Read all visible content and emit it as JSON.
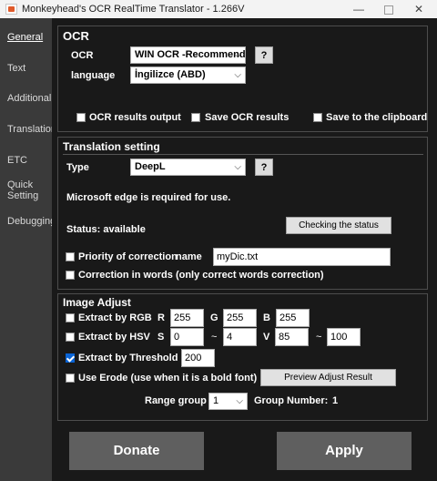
{
  "window": {
    "title": "Monkeyhead's OCR RealTime Translator - 1.266V",
    "min_glyph": "—",
    "close_glyph": "✕"
  },
  "sidebar": {
    "items": [
      {
        "label": "General",
        "active": true
      },
      {
        "label": "Text"
      },
      {
        "label": "Additional"
      },
      {
        "label": "Translation"
      },
      {
        "label": "ETC"
      },
      {
        "label": "Quick Setting"
      },
      {
        "label": "Debugging"
      }
    ]
  },
  "ocr": {
    "title": "OCR",
    "ocr_label": "OCR",
    "ocr_value": "WIN OCR -Recommended",
    "language_label": "language",
    "language_value": "İngilizce (ABD)",
    "help_label": "?",
    "results_output": {
      "label": "OCR results output",
      "checked": false
    },
    "save_results": {
      "label": "Save OCR results",
      "checked": false
    },
    "save_clipboard": {
      "label": "Save to the clipboard",
      "checked": false
    }
  },
  "translation": {
    "title": "Translation setting",
    "type_label": "Type",
    "type_value": "DeepL",
    "help_label": "?",
    "note": "Microsoft edge is required for use.",
    "status": "Status: available",
    "check_button": "Checking the status",
    "priority": {
      "label": "Priority of correction",
      "checked": false
    },
    "name_label": "name",
    "name_value": "myDic.txt",
    "words": {
      "label": "Correction in words (only correct words correction)",
      "checked": false
    }
  },
  "image_adjust": {
    "title": "Image Adjust",
    "rgb": {
      "label": "Extract by RGB",
      "checked": false,
      "r_label": "R",
      "r": "255",
      "g_label": "G",
      "g": "255",
      "b_label": "B",
      "b": "255"
    },
    "hsv": {
      "label": "Extract by HSV",
      "checked": false,
      "s_label": "S",
      "s_min": "0",
      "s_tilde": "~",
      "s_max": "4",
      "v_label": "V",
      "v_min": "85",
      "v_tilde": "~",
      "v_max": "100"
    },
    "threshold": {
      "label": "Extract by Threshold",
      "checked": true,
      "value": "200"
    },
    "erode": {
      "label": "Use Erode (use when it is a bold font)",
      "checked": false
    },
    "preview_button": "Preview Adjust Result",
    "range_group_label": "Range group",
    "range_group_value": "1",
    "group_number_label": "Group Number:",
    "group_number_value": "1"
  },
  "footer": {
    "donate": "Donate",
    "apply": "Apply"
  },
  "colors": {
    "background": "#191919",
    "sidebar": "#3a3a3a",
    "checkbox_accent": "#0a64d6",
    "big_button": "#5f5f5f"
  }
}
